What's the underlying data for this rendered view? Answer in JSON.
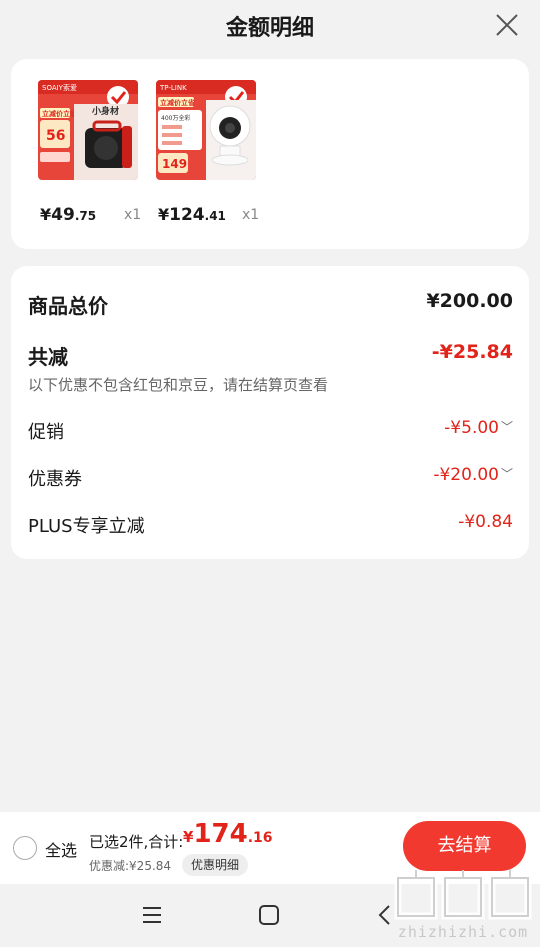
{
  "header": {
    "title": "金额明细"
  },
  "products": [
    {
      "thumb_brand": "SOAIY索爱",
      "thumb_banner": "立减价立省",
      "thumb_price": "56",
      "thumb_slogan": "小身材",
      "price_yen": "¥",
      "price_int": "49",
      "price_dec": ".75",
      "qty": "x1"
    },
    {
      "thumb_brand": "TP-LINK",
      "thumb_banner": "立减价立省",
      "thumb_price": "149",
      "thumb_slogan": "400万全彩",
      "price_yen": "¥",
      "price_int": "124",
      "price_dec": ".41",
      "qty": "x1"
    }
  ],
  "summary": {
    "goods_total_label": "商品总价",
    "goods_total_value": "¥200.00",
    "reduction_label": "共减",
    "reduction_value": "-¥25.84",
    "reduction_note": "以下优惠不包含红包和京豆，请在结算页查看",
    "lines": [
      {
        "label": "促销",
        "value": "-¥5.00",
        "expandable": true
      },
      {
        "label": "优惠券",
        "value": "-¥20.00",
        "expandable": true
      },
      {
        "label": "PLUS专享立减",
        "value": "-¥0.84",
        "expandable": false
      }
    ]
  },
  "bottom_bar": {
    "select_all_label": "全选",
    "selected_info": "已选2件,合计:",
    "total_yen": "¥",
    "total_int": "174",
    "total_dec": ".16",
    "discount_text": "优惠减:¥25.84",
    "detail_label": "优惠明细",
    "checkout_label": "去结算"
  },
  "watermark": {
    "text": "zhizhizhi.com"
  },
  "colors": {
    "accent_red": "#e2231a",
    "button_red": "#f2392f",
    "background": "#f2f2f2"
  }
}
